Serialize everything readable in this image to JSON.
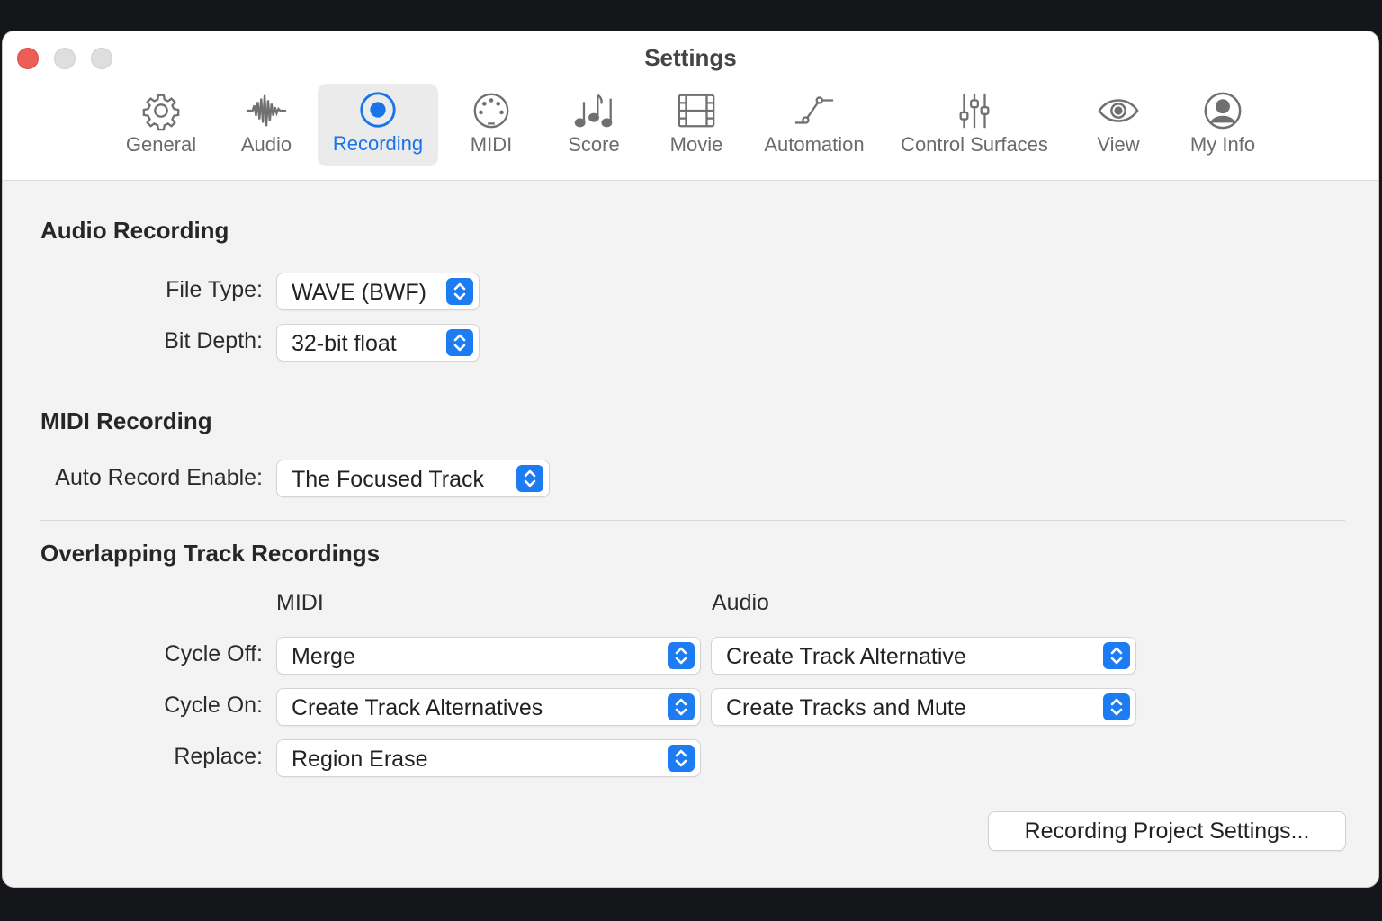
{
  "window": {
    "title": "Settings"
  },
  "toolbar": {
    "tabs": [
      {
        "label": "General",
        "icon": "gear-icon"
      },
      {
        "label": "Audio",
        "icon": "waveform-icon"
      },
      {
        "label": "Recording",
        "icon": "record-icon",
        "active": true
      },
      {
        "label": "MIDI",
        "icon": "midi-connector-icon"
      },
      {
        "label": "Score",
        "icon": "music-notes-icon"
      },
      {
        "label": "Movie",
        "icon": "film-icon"
      },
      {
        "label": "Automation",
        "icon": "automation-curve-icon"
      },
      {
        "label": "Control Surfaces",
        "icon": "sliders-icon"
      },
      {
        "label": "View",
        "icon": "eye-icon"
      },
      {
        "label": "My Info",
        "icon": "person-circle-icon"
      }
    ]
  },
  "audio_recording": {
    "title": "Audio Recording",
    "file_type_label": "File Type:",
    "file_type_value": "WAVE (BWF)",
    "bit_depth_label": "Bit Depth:",
    "bit_depth_value": "32-bit float"
  },
  "midi_recording": {
    "title": "MIDI Recording",
    "auto_record_label": "Auto Record Enable:",
    "auto_record_value": "The Focused Track"
  },
  "overlapping": {
    "title": "Overlapping Track Recordings",
    "midi_header": "MIDI",
    "audio_header": "Audio",
    "cycle_off_label": "Cycle Off:",
    "cycle_off_midi": "Merge",
    "cycle_off_audio": "Create Track Alternative",
    "cycle_on_label": "Cycle On:",
    "cycle_on_midi": "Create Track Alternatives",
    "cycle_on_audio": "Create Tracks and Mute",
    "replace_label": "Replace:",
    "replace_midi": "Region Erase"
  },
  "footer": {
    "project_settings_button": "Recording Project Settings..."
  },
  "colors": {
    "accent": "#1d7cf2",
    "active_tab_text": "#1a73e8",
    "close_button": "#ec5f57"
  }
}
